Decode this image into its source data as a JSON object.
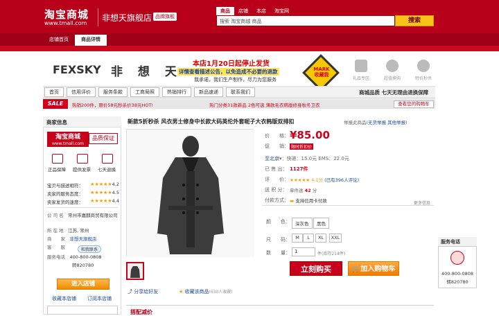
{
  "header": {
    "logo_cn": "淘宝商城",
    "logo_url": "www.tmall.com",
    "shop_name": "非想天旗舰店",
    "shop_badge": "品牌旗舰",
    "search_tabs": [
      "商品",
      "店铺",
      "本店",
      "淘宝网"
    ],
    "search_value": "搜索  淘宝商城  商品",
    "search_button": "搜索"
  },
  "nav": {
    "tabs": [
      "店铺首页",
      "商品详情"
    ]
  },
  "brand": {
    "name_en": "FEXSKY",
    "name_cn": "非 想 天",
    "promo_line1": "本店1月20日起停止发货",
    "promo_line2": "详情查看描述公告，以免造成不必要的退款",
    "promo_line3": "我承诺，我们生产制作，尽力为您服务",
    "mark_badge": "MARK 收藏我",
    "services": [
      "礼品专区",
      "超值换购",
      "特价秒杀"
    ]
  },
  "shop_nav": {
    "buttons": [
      "首页",
      "信用评价",
      "服务条款",
      "工商局照",
      "热销排行",
      "新品速递",
      "联系我们"
    ],
    "slogan": "商城品质 七天无理由退换保障"
  },
  "sale_bar": {
    "tag": "SALE",
    "item1": "热销200件，原价58元秒杀价38元HOT!",
    "item2": "热门分类31款新品 2色可选 薄款毛衣韩版修身秋冬卫衣",
    "button": "查看您的购物车"
  },
  "left": {
    "title": "商家信息",
    "tmall_logo": "淘宝商城",
    "tmall_url": "www.tmall.com",
    "quality": "品质保证",
    "guarantees": [
      "正品保障",
      "提供发票",
      "七天退换"
    ],
    "ratings": [
      {
        "label": "宝贝与描述相符：",
        "score": "4.2"
      },
      {
        "label": "卖家的服务态度：",
        "score": "4.5"
      },
      {
        "label": "卖家发货的速度：",
        "score": "4.4"
      }
    ],
    "company_k": "公 司 名",
    "company_v": "常州市嘉麒商贸有限公司",
    "location_k": "所 在 地",
    "location_v": "江苏, 常州",
    "seller_k": "商　　家",
    "seller_v": "非想天旗舰店",
    "service_k": "客　　服",
    "service_v": "和我联系",
    "phone_k": "服务电话",
    "phone_v": "400-800-0808",
    "phone_ext": "转820780",
    "enter_shop": "进入店铺",
    "fav_shop": "收藏本店铺",
    "fav_all": "订阅本店铺"
  },
  "product": {
    "title": "新款5折秒杀  风衣男士修身中长款大码英伦外套呢子大衣韩版双排扣",
    "top_links_prefix": "举报此商品(",
    "top_link1": "无货举报",
    "top_link2": "其他举报",
    "top_links_suffix": ")",
    "price_label": "价　　格：",
    "price": "¥85.00",
    "discount_label": "促　　销：",
    "discount_tag": "限时折扣价",
    "shipping_label": "至北京",
    "shipping_text": "快递：15.0元  EMS：22.0元",
    "sold_label": "已 售 出：",
    "sold_value": "1127件",
    "rating_label": "评　　价：",
    "rating_text": "★★★★★ 4.1分",
    "rating_link": "(已有396人评论)",
    "points_label": "送 积 分：",
    "points_text": "单件送",
    "points_value": "42",
    "points_unit": "分",
    "pay_label": "付款方式：",
    "pay_value": "支持信用卡付款",
    "more": "更多信息",
    "color_label": "颜　　色：",
    "colors": [
      "深灰色",
      "黑色"
    ],
    "size_label": "尺　　码：",
    "sizes": [
      "M",
      "L",
      "XL",
      "XXL"
    ],
    "qty_label": "数　　量：",
    "qty_value": "1",
    "stock": "件(库存214件)",
    "buy_button": "立刻购买",
    "cart_button": "加入购物车",
    "share": "分享给好友",
    "favorite": "收藏该商品",
    "favorite_count": "(630人收藏)",
    "recommend_title": "搭配减价"
  },
  "service_box": {
    "title": "服务电话",
    "tel": "400-800-0808",
    "ext": "转820780"
  },
  "colors": {
    "brand_red": "#b8001a",
    "price_red": "#d0001a",
    "link_blue": "#1a4aa0",
    "cart_orange": "#f08a00"
  }
}
